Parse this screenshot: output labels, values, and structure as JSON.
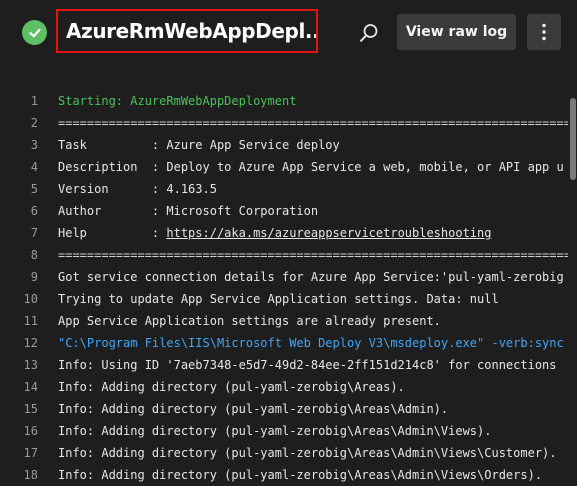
{
  "header": {
    "title": "AzureRmWebAppDepl...",
    "view_raw_log": "View raw log",
    "status_icon": "check-circle-icon",
    "search_icon": "search-icon",
    "more_icon": "more-vertical-icon",
    "colors": {
      "success": "#5fbf65",
      "highlight_border": "#e01515",
      "button_bg": "#3b3b3b"
    }
  },
  "log": {
    "lines": [
      {
        "num": "1",
        "text": "Starting: AzureRmWebAppDeployment",
        "style": "green"
      },
      {
        "num": "2",
        "text": "==============================================================================",
        "style": "sep"
      },
      {
        "num": "3",
        "text": "Task         : Azure App Service deploy",
        "style": ""
      },
      {
        "num": "4",
        "text": "Description  : Deploy to Azure App Service a web, mobile, or API app u",
        "style": ""
      },
      {
        "num": "5",
        "text": "Version      : 4.163.5",
        "style": ""
      },
      {
        "num": "6",
        "text": "Author       : Microsoft Corporation",
        "style": ""
      },
      {
        "num": "7",
        "text": "Help         : ",
        "link": "https://aka.ms/azureappservicetroubleshooting",
        "style": ""
      },
      {
        "num": "8",
        "text": "==============================================================================",
        "style": "sep"
      },
      {
        "num": "9",
        "text": "Got service connection details for Azure App Service:'pul-yaml-zerobig",
        "style": ""
      },
      {
        "num": "10",
        "text": "Trying to update App Service Application settings. Data: null",
        "style": ""
      },
      {
        "num": "11",
        "text": "App Service Application settings are already present.",
        "style": ""
      },
      {
        "num": "12",
        "text": "\"C:\\Program Files\\IIS\\Microsoft Web Deploy V3\\msdeploy.exe\" -verb:sync",
        "style": "blue"
      },
      {
        "num": "13",
        "text": "Info: Using ID '7aeb7348-e5d7-49d2-84ee-2ff151d214c8' for connections",
        "style": ""
      },
      {
        "num": "14",
        "text": "Info: Adding directory (pul-yaml-zerobig\\Areas).",
        "style": ""
      },
      {
        "num": "15",
        "text": "Info: Adding directory (pul-yaml-zerobig\\Areas\\Admin).",
        "style": ""
      },
      {
        "num": "16",
        "text": "Info: Adding directory (pul-yaml-zerobig\\Areas\\Admin\\Views).",
        "style": ""
      },
      {
        "num": "17",
        "text": "Info: Adding directory (pul-yaml-zerobig\\Areas\\Admin\\Views\\Customer).",
        "style": ""
      },
      {
        "num": "18",
        "text": "Info: Adding directory (pul-yaml-zerobig\\Areas\\Admin\\Views\\Orders).",
        "style": ""
      }
    ],
    "colors": {
      "text": "#e6e6e6",
      "line_number": "#9a9a9a",
      "section_start": "#49c15a",
      "command": "#3fa6f5"
    }
  }
}
